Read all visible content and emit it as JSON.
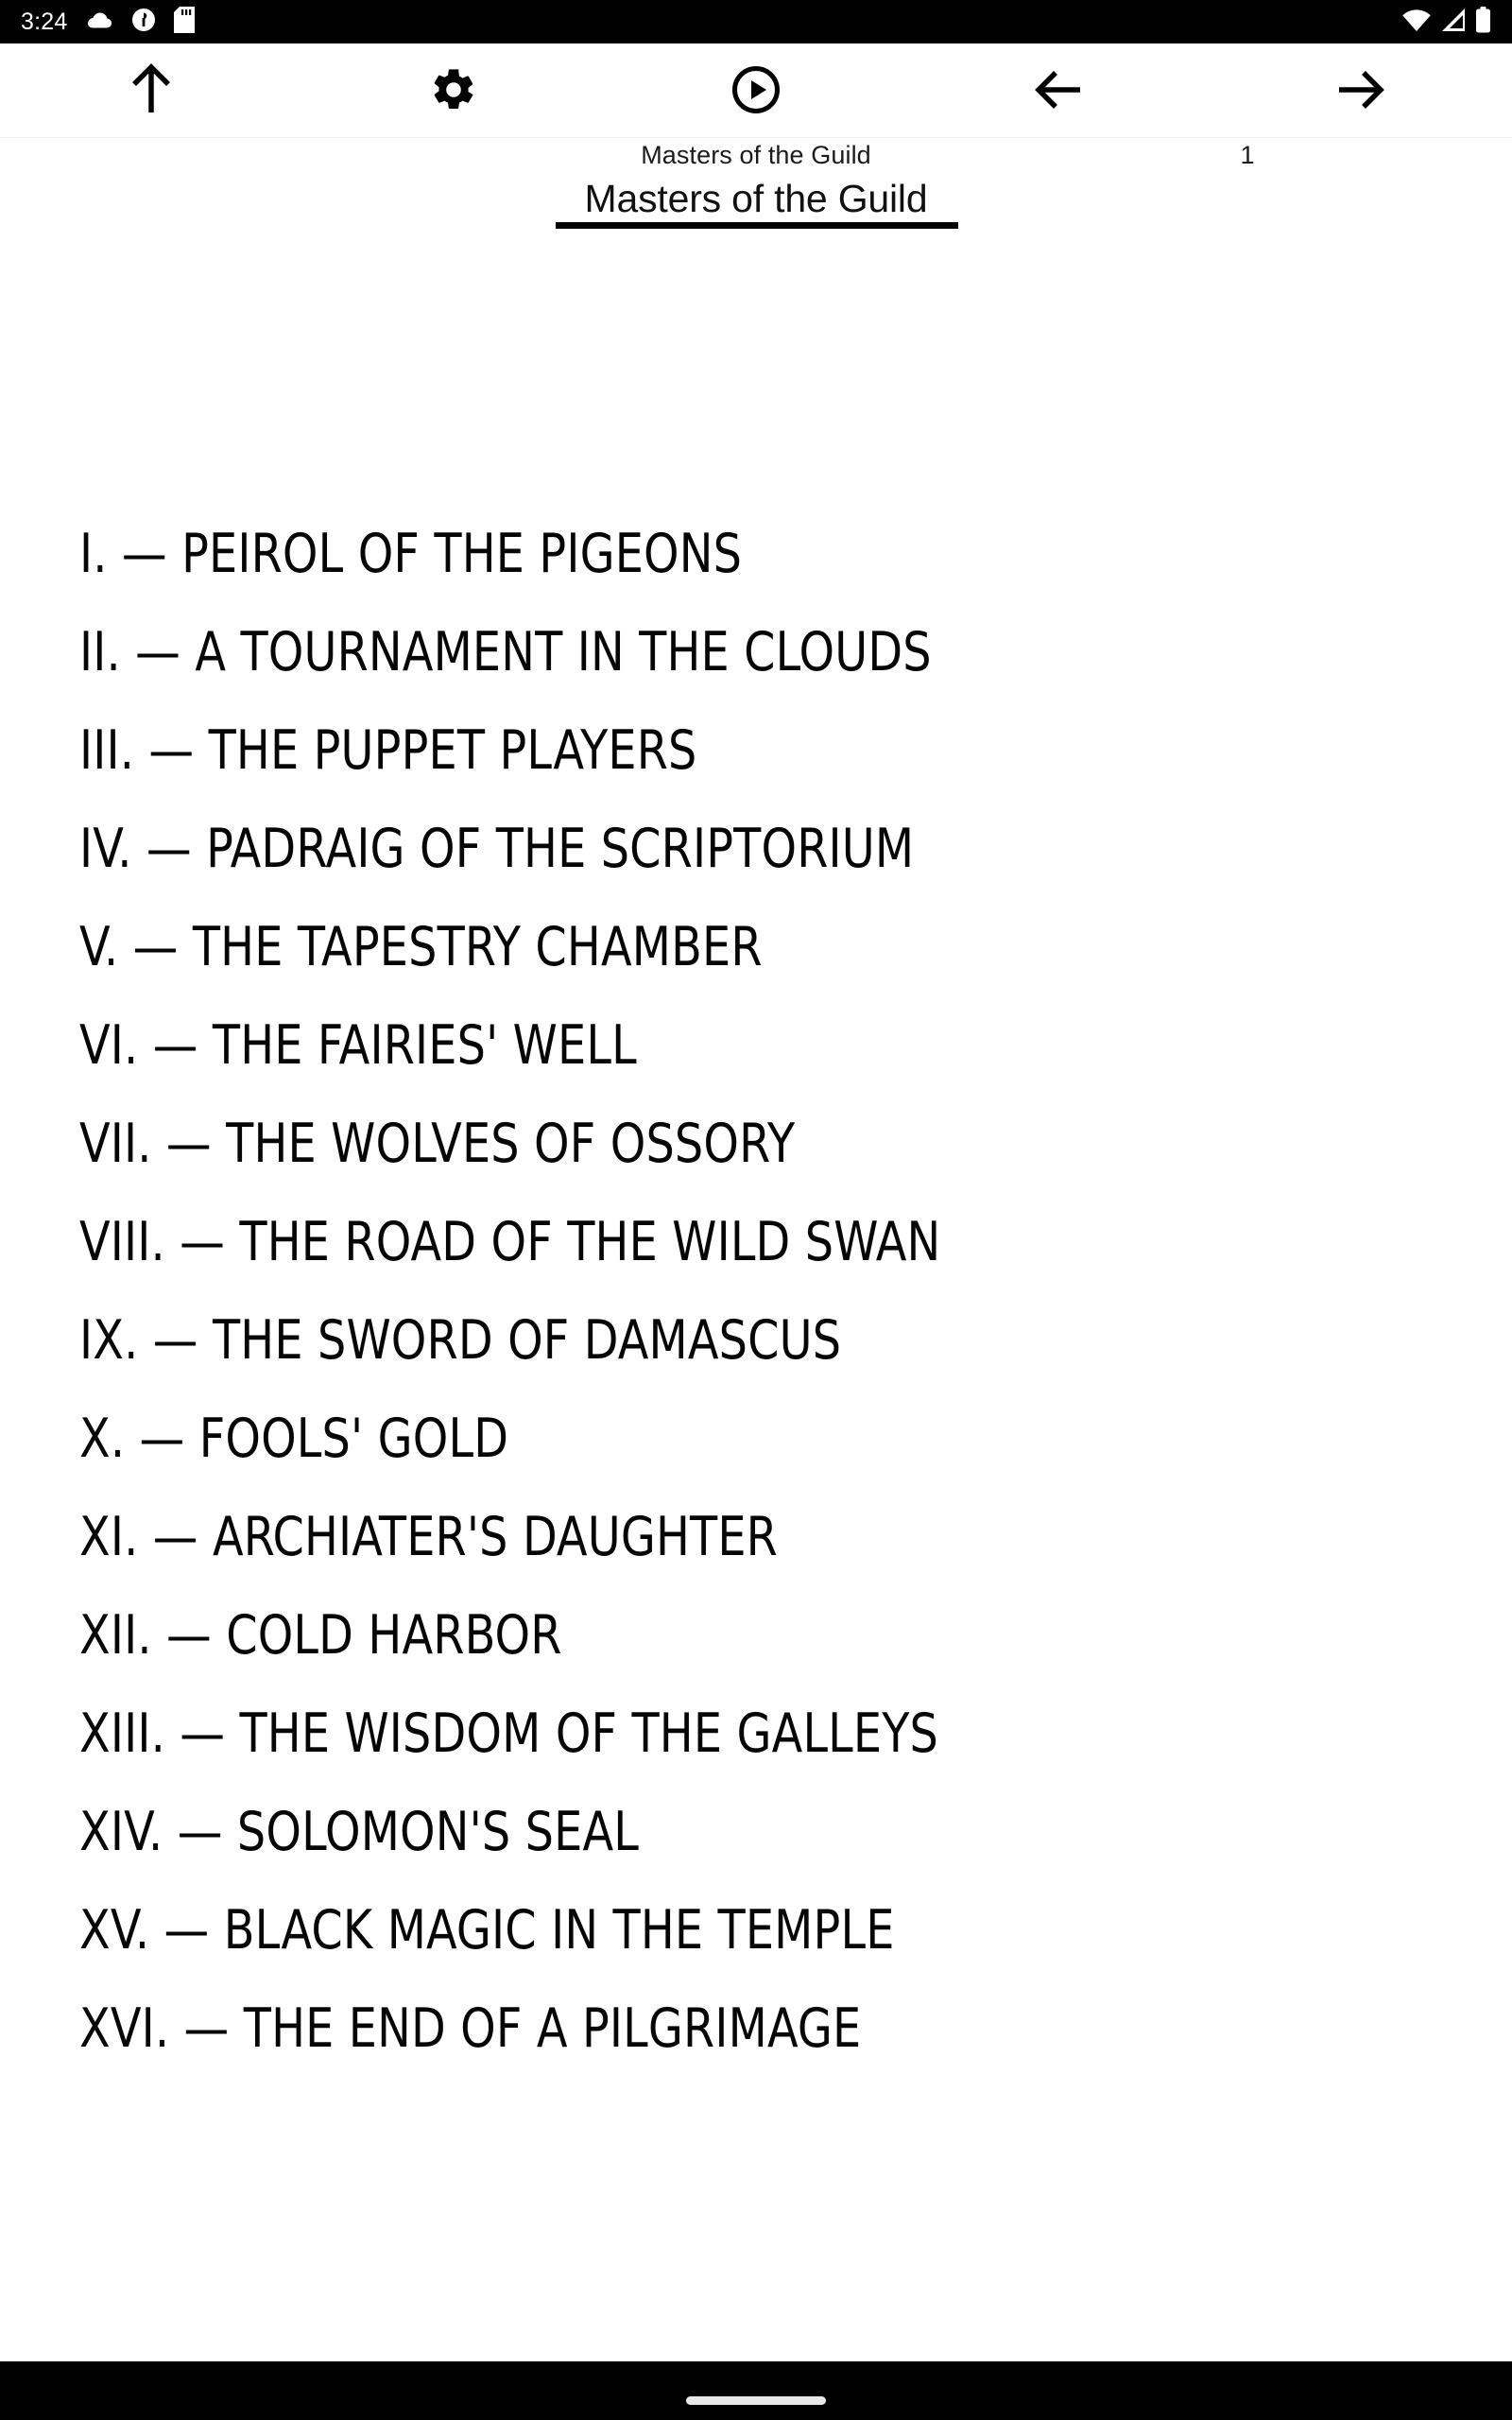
{
  "status_bar": {
    "time": "3:24",
    "left_icons": [
      "cloud-icon",
      "circle-half-icon",
      "sd-card-icon"
    ],
    "right_icons": [
      "wifi-icon",
      "cellular-signal-icon",
      "battery-icon"
    ],
    "background": "#000000",
    "foreground": "#ffffff"
  },
  "toolbar": {
    "buttons": [
      {
        "name": "scroll-to-top-button",
        "icon": "arrow-up-icon"
      },
      {
        "name": "settings-button",
        "icon": "gear-icon"
      },
      {
        "name": "read-aloud-button",
        "icon": "play-circle-icon"
      },
      {
        "name": "previous-page-button",
        "icon": "arrow-left-icon"
      },
      {
        "name": "next-page-button",
        "icon": "arrow-right-icon"
      }
    ]
  },
  "header": {
    "subtitle": "Masters of the Guild",
    "title": "Masters of the Guild",
    "page_number": "1"
  },
  "toc": {
    "items": [
      "I. — PEIROL OF THE PIGEONS",
      "II. — A TOURNAMENT IN THE CLOUDS",
      "III. — THE PUPPET PLAYERS",
      "IV. — PADRAIG OF THE SCRIPTORIUM",
      "V. — THE TAPESTRY CHAMBER",
      "VI. — THE FAIRIES' WELL",
      "VII. — THE WOLVES OF OSSORY",
      "VIII. — THE ROAD OF THE WILD SWAN",
      "IX. — THE SWORD OF DAMASCUS",
      "X. — FOOLS' GOLD",
      "XI. — ARCHIATER'S DAUGHTER",
      "XII. — COLD HARBOR",
      "XIII. — THE WISDOM OF THE GALLEYS",
      "XIV. — SOLOMON'S SEAL",
      "XV. — BLACK MAGIC IN THE TEMPLE",
      "XVI. — THE END OF A PILGRIMAGE"
    ]
  },
  "nav_bar": {
    "gesture_pill": "home-gesture-pill",
    "background": "#000000"
  },
  "colors": {
    "page_background": "#ffffff",
    "text": "#060606",
    "system_bar": "#000000"
  }
}
